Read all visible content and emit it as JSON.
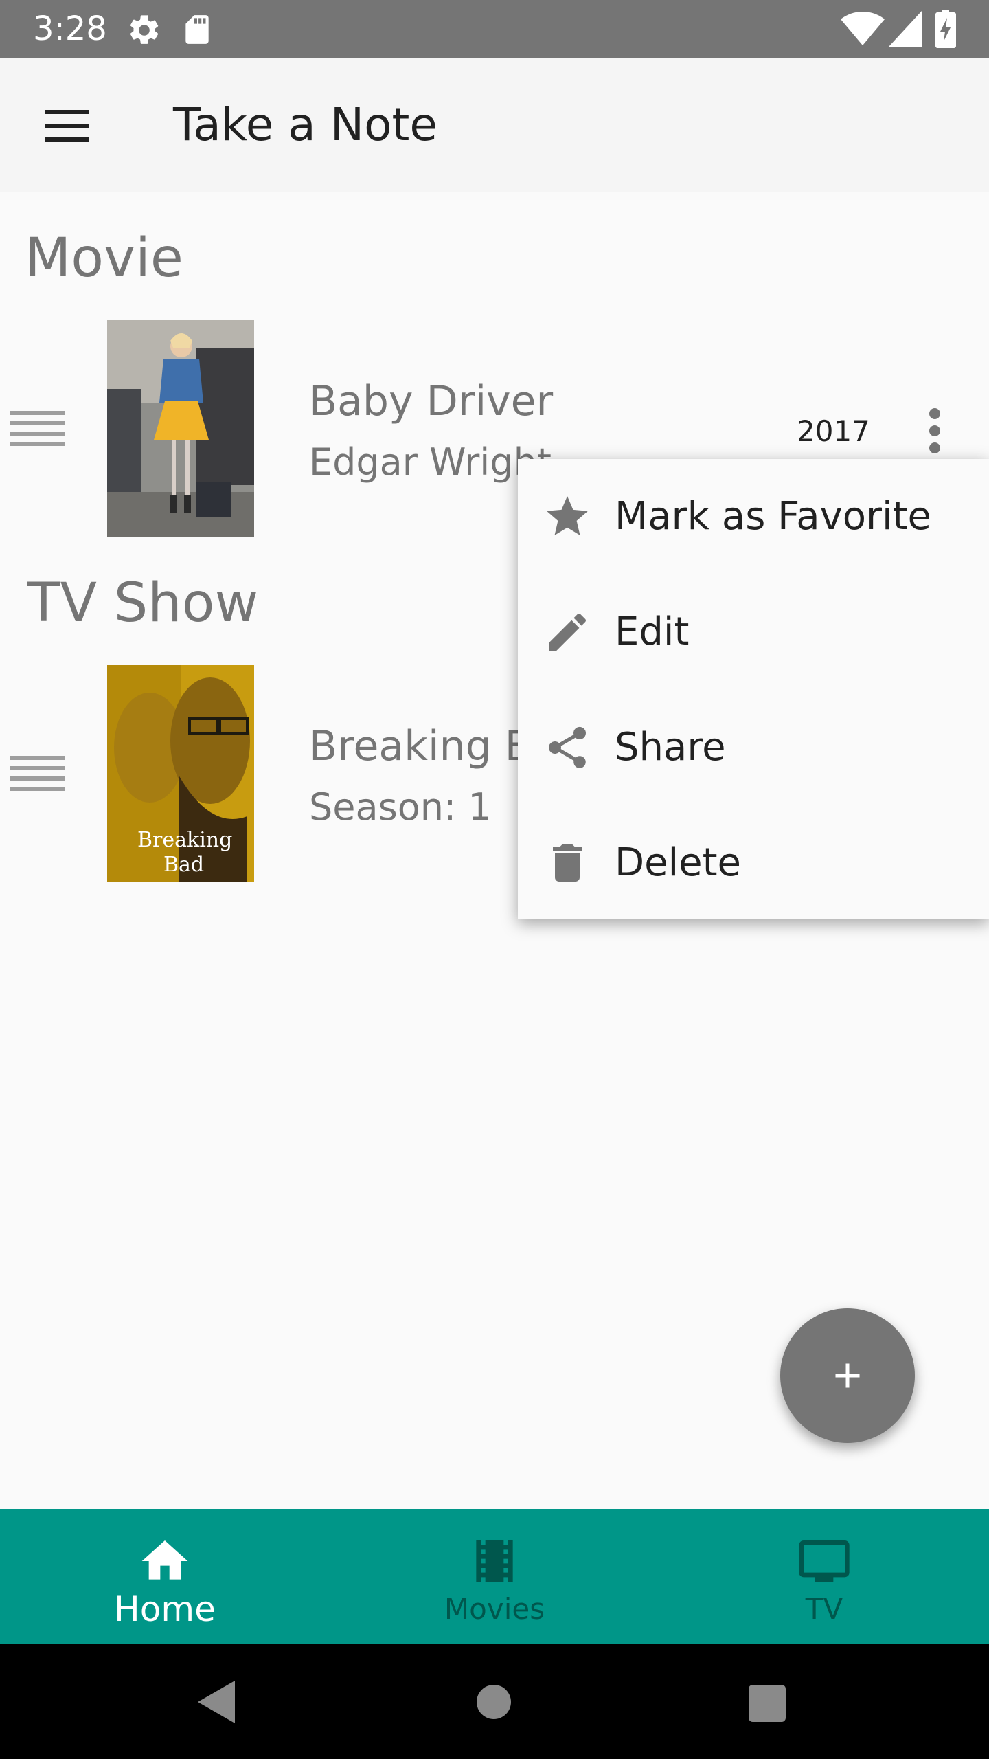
{
  "status_bar": {
    "time": "3:28",
    "icons": [
      "settings-icon",
      "sd-card-icon",
      "wifi-icon",
      "cell-signal-icon",
      "battery-charging-icon"
    ]
  },
  "app_bar": {
    "menu_icon": "hamburger-menu-icon",
    "title": "Take a Note"
  },
  "sections": {
    "movie": {
      "title": "Movie",
      "item": {
        "title": "Baby Driver",
        "subtitle": "Edgar Wright",
        "year": "2017"
      }
    },
    "tv": {
      "title": "TV Show",
      "item": {
        "title": "Breaking Ba",
        "subtitle": "Season: 1",
        "poster_text_1": "Breaking",
        "poster_text_2": "Bad"
      }
    }
  },
  "popup_menu": {
    "items": [
      {
        "label": "Mark as Favorite",
        "icon": "star-icon"
      },
      {
        "label": "Edit",
        "icon": "pencil-icon"
      },
      {
        "label": "Share",
        "icon": "share-icon"
      },
      {
        "label": "Delete",
        "icon": "trash-icon"
      }
    ]
  },
  "fab": {
    "icon": "plus-icon"
  },
  "bottom_nav": {
    "selected": "Home",
    "items": [
      {
        "label": "Home",
        "icon": "home-icon"
      },
      {
        "label": "Movies",
        "icon": "film-icon"
      },
      {
        "label": "TV",
        "icon": "tv-icon"
      }
    ]
  },
  "colors": {
    "accent": "#009688",
    "status_bar": "#757575",
    "nav_selected": "#ffffff",
    "nav_unselected": "#00574d",
    "fab": "#757575"
  }
}
